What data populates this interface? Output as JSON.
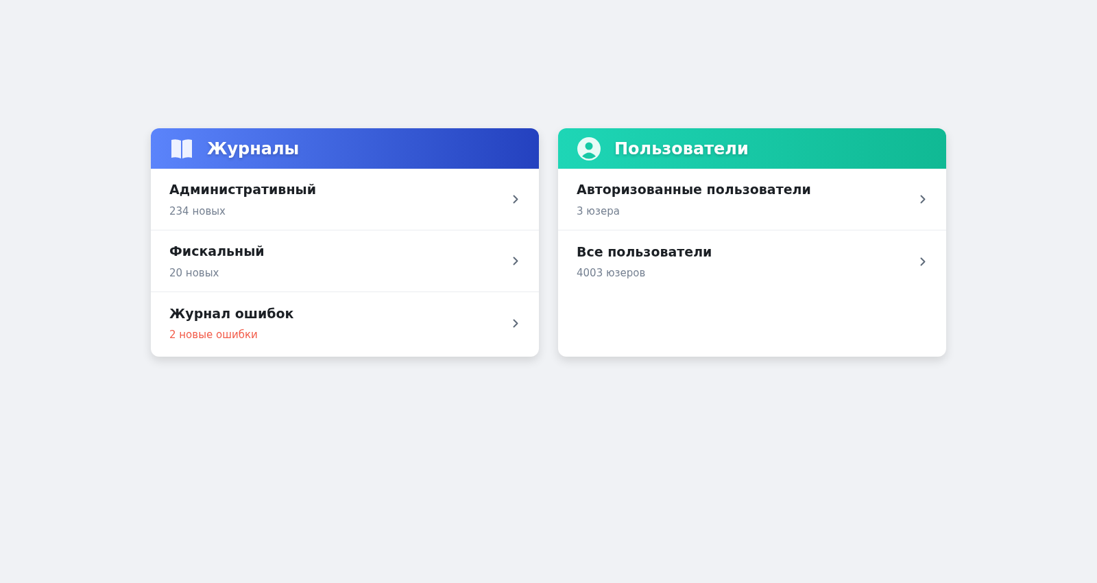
{
  "cards": [
    {
      "kind": "journals",
      "title": "Журналы",
      "items": [
        {
          "title": "Административный",
          "subtitle": "234 новых",
          "alert": false
        },
        {
          "title": "Фискальный",
          "subtitle": "20 новых",
          "alert": false
        },
        {
          "title": "Журнал ошибок",
          "subtitle": "2 новые ошибки",
          "alert": true
        }
      ]
    },
    {
      "kind": "users",
      "title": "Пользователи",
      "items": [
        {
          "title": "Авторизованные пользователи",
          "subtitle": "3 юзера",
          "alert": false
        },
        {
          "title": "Все пользователи",
          "subtitle": "4003 юзеров",
          "alert": false
        }
      ]
    }
  ]
}
